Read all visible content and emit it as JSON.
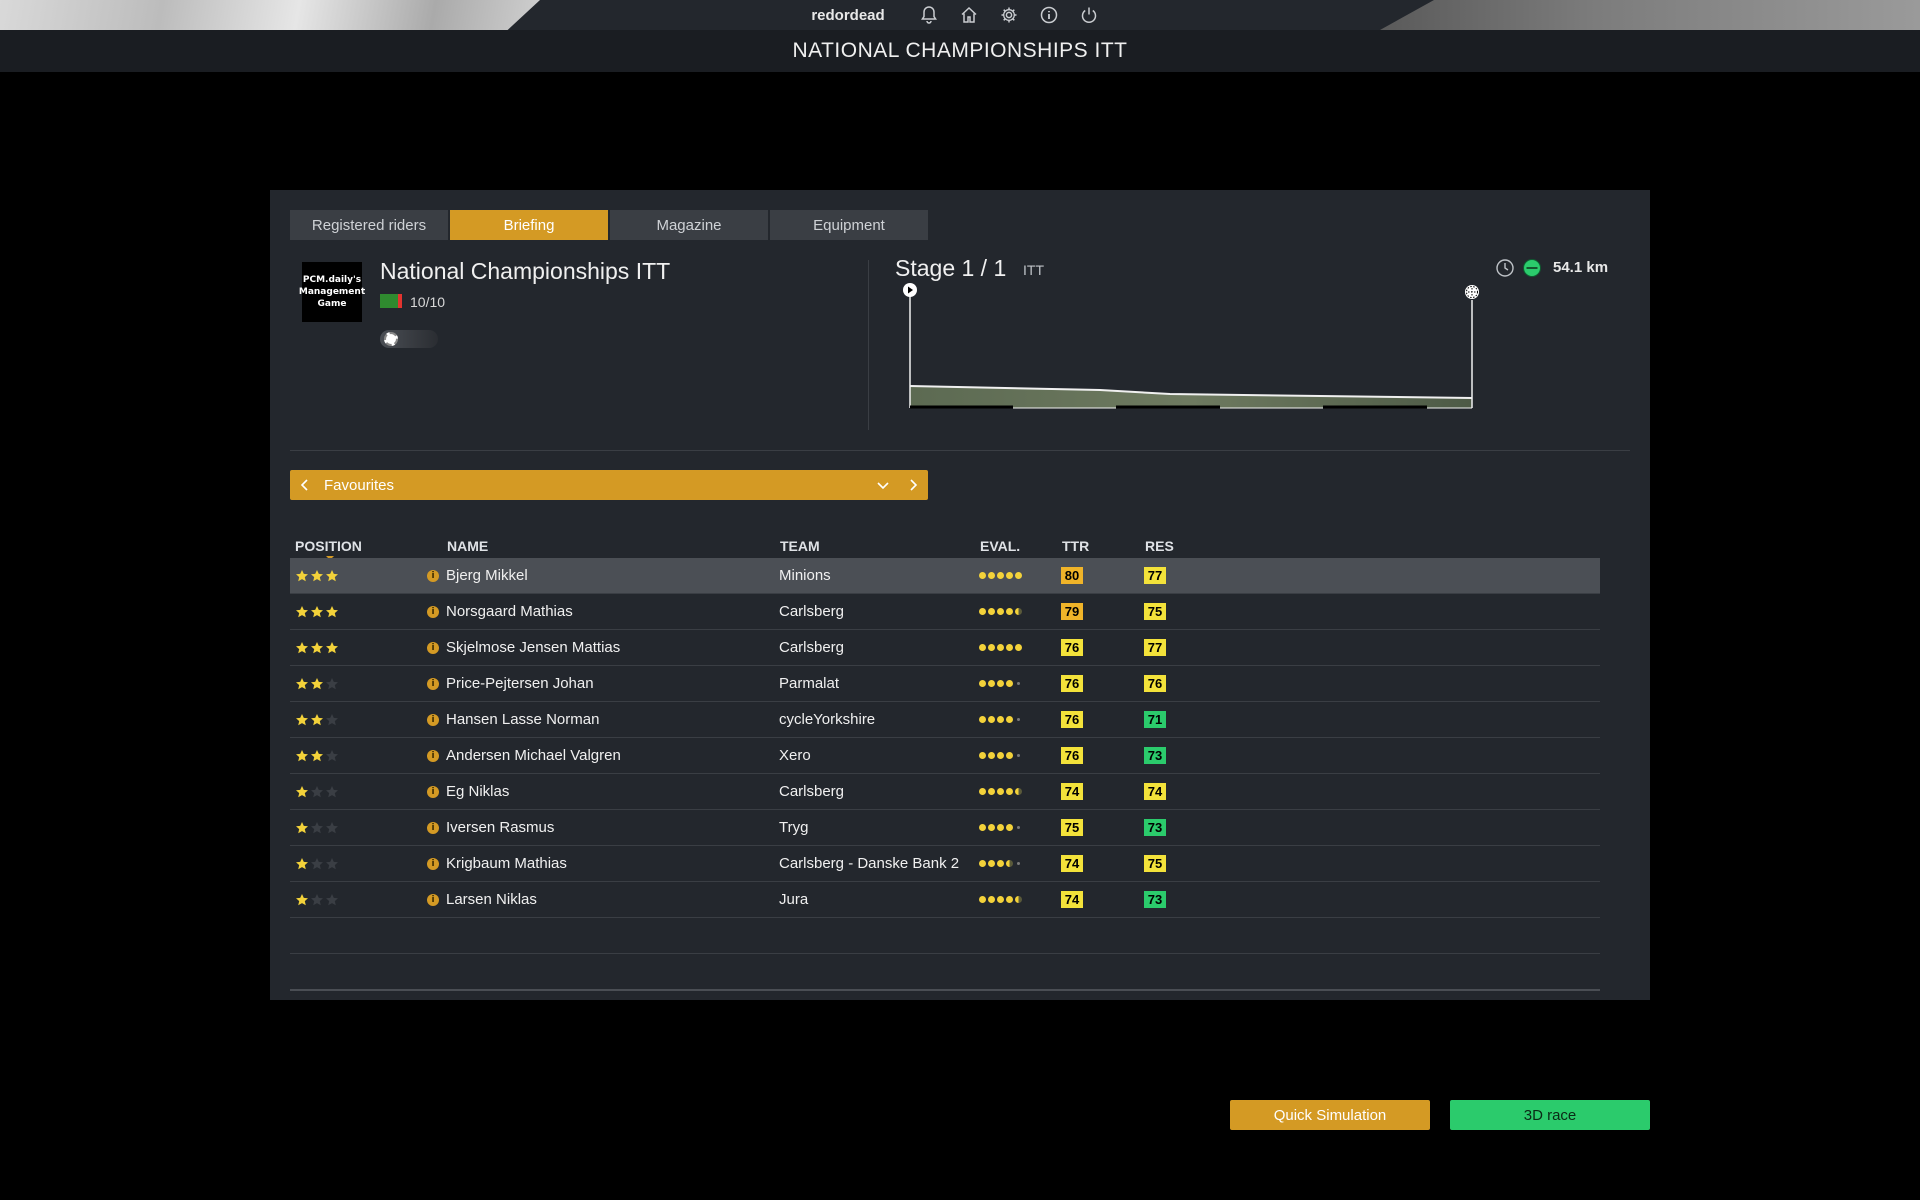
{
  "topbar": {
    "username": "redordead",
    "icons": [
      "bell-icon",
      "home-icon",
      "gear-icon",
      "info-icon",
      "power-icon"
    ]
  },
  "page_title": "NATIONAL CHAMPIONSHIPS ITT",
  "tabs": [
    {
      "label": "Registered riders",
      "active": false
    },
    {
      "label": "Briefing",
      "active": true
    },
    {
      "label": "Magazine",
      "active": false
    },
    {
      "label": "Equipment",
      "active": false
    }
  ],
  "race": {
    "logo_text": "PCM.daily's Management Game",
    "name": "National Championships ITT",
    "rating": "10/10"
  },
  "stage": {
    "title": "Stage 1 / 1",
    "type": "ITT",
    "distance": "54.1 km"
  },
  "favourites": {
    "label": "Favourites"
  },
  "table": {
    "headers": {
      "position": "POSITION",
      "name": "NAME",
      "team": "TEAM",
      "eval": "EVAL.",
      "ttr": "TTR",
      "res": "RES"
    },
    "rows": [
      {
        "stars": 3,
        "name": "Bjerg Mikkel",
        "team": "Minions",
        "eval": 5,
        "ttr": "80",
        "ttr_color": "#f0b429",
        "res": "77",
        "res_color": "#f3e23a",
        "selected": true
      },
      {
        "stars": 3,
        "name": "Norsgaard Mathias",
        "team": "Carlsberg",
        "eval": 4.5,
        "ttr": "79",
        "ttr_color": "#f0b429",
        "res": "75",
        "res_color": "#f3e23a",
        "selected": false
      },
      {
        "stars": 3,
        "name": "Skjelmose Jensen Mattias",
        "team": "Carlsberg",
        "eval": 5,
        "ttr": "76",
        "ttr_color": "#f3e23a",
        "res": "77",
        "res_color": "#f3e23a",
        "selected": false
      },
      {
        "stars": 2,
        "name": "Price-Pejtersen Johan",
        "team": "Parmalat",
        "eval": 4,
        "ttr": "76",
        "ttr_color": "#f3e23a",
        "res": "76",
        "res_color": "#f3e23a",
        "selected": false
      },
      {
        "stars": 2,
        "name": "Hansen Lasse Norman",
        "team": "cycleYorkshire",
        "eval": 4,
        "ttr": "76",
        "ttr_color": "#f3e23a",
        "res": "71",
        "res_color": "#2bcb6c",
        "selected": false
      },
      {
        "stars": 2,
        "name": "Andersen Michael Valgren",
        "team": "Xero",
        "eval": 4,
        "ttr": "76",
        "ttr_color": "#f3e23a",
        "res": "73",
        "res_color": "#2bcb6c",
        "selected": false
      },
      {
        "stars": 1,
        "name": "Eg Niklas",
        "team": "Carlsberg",
        "eval": 4.5,
        "ttr": "74",
        "ttr_color": "#f3e23a",
        "res": "74",
        "res_color": "#f3e23a",
        "selected": false
      },
      {
        "stars": 1,
        "name": "Iversen Rasmus",
        "team": "Tryg",
        "eval": 4,
        "ttr": "75",
        "ttr_color": "#f3e23a",
        "res": "73",
        "res_color": "#2bcb6c",
        "selected": false
      },
      {
        "stars": 1,
        "name": "Krigbaum Mathias",
        "team": "Carlsberg - Danske Bank 2",
        "eval": 3.5,
        "ttr": "74",
        "ttr_color": "#f3e23a",
        "res": "75",
        "res_color": "#f3e23a",
        "selected": false
      },
      {
        "stars": 1,
        "name": "Larsen Niklas",
        "team": "Jura",
        "eval": 4.5,
        "ttr": "74",
        "ttr_color": "#f3e23a",
        "res": "73",
        "res_color": "#2bcb6c",
        "selected": false
      }
    ]
  },
  "buttons": {
    "quick_simulation": "Quick Simulation",
    "race_3d": "3D race"
  },
  "colors": {
    "accent": "#d49a24",
    "go": "#2bcb6c",
    "panel": "#23272d"
  }
}
